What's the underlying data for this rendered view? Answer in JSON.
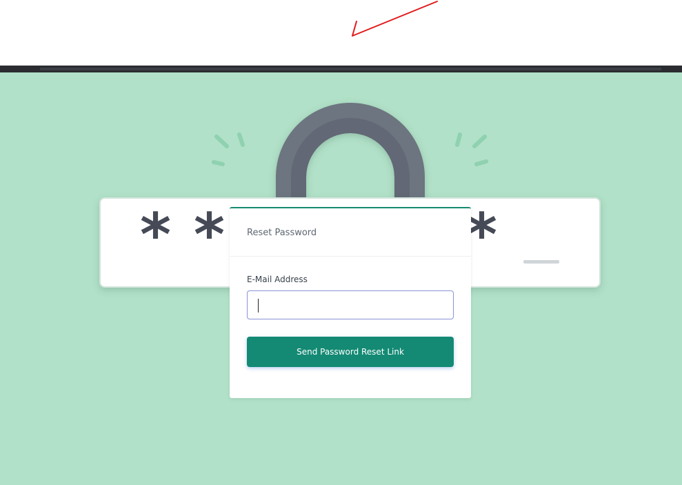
{
  "reset_card": {
    "header_title": "Reset Password",
    "email_label": "E-Mail Address",
    "email_value": "",
    "email_placeholder": "",
    "submit_label": "Send Password Reset Link"
  },
  "illustration": {
    "mask_characters": [
      "*",
      "*",
      "*"
    ],
    "icons": [
      "padlock-shackle-icon",
      "sparkle-left-icon",
      "sparkle-right-icon",
      "text-cursor-icon"
    ]
  },
  "colors": {
    "background": "#b1e1c8",
    "accent": "#148a74",
    "padlock": "#6d7480",
    "sparkle": "#8fd1b0",
    "annotation_stroke": "#e0191b",
    "input_border": "#8a92d8"
  }
}
